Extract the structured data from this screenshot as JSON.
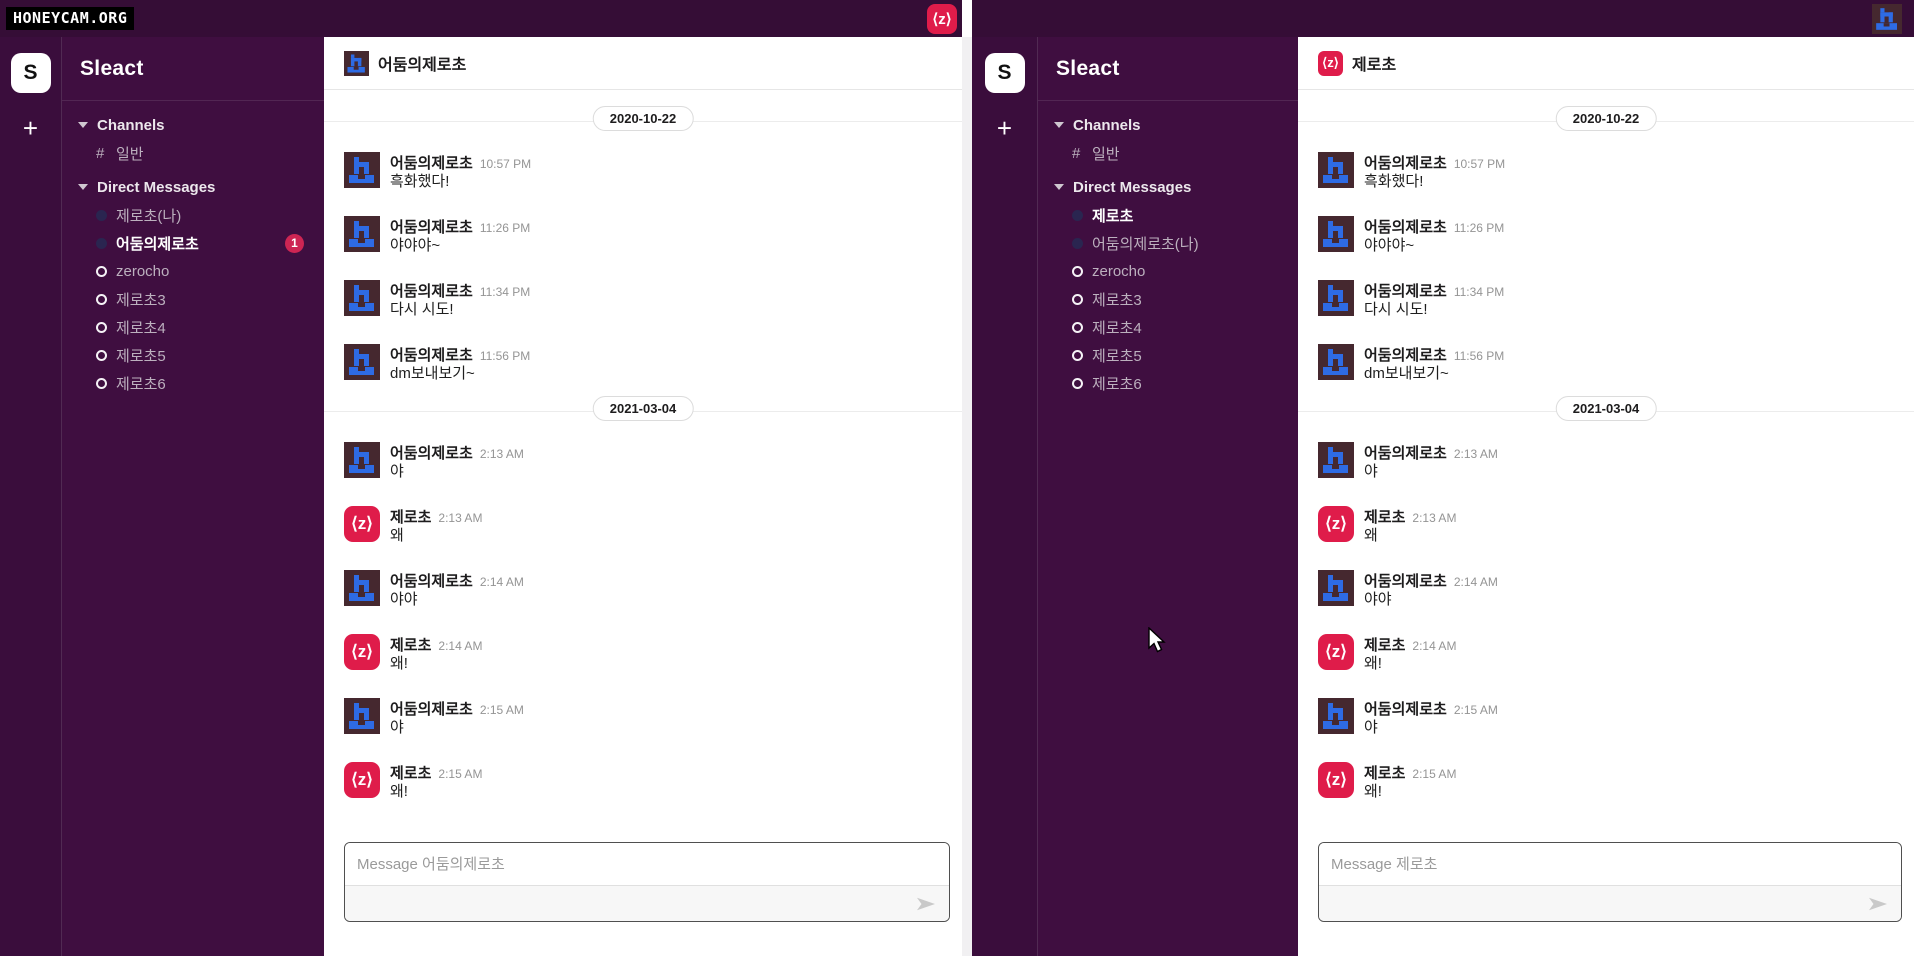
{
  "topbar": {
    "watermark": "HONEYCAM.ORG"
  },
  "icons": {
    "z_glyph": "⟨z⟩",
    "hash_glyph": "#"
  },
  "colors": {
    "topbar": "#350d36",
    "sidebar": "#3f0e40",
    "workspace": "#3a0d3c",
    "accent_red": "#df1c4a",
    "badge_red": "#cd2553",
    "avatar_blue": "#2e6be4",
    "avatar_bg": "#45282f",
    "muted_sidebar_text": "#bcb0be"
  },
  "windows": [
    {
      "workspace": {
        "initial": "S",
        "add_label": "+"
      },
      "sidebar": {
        "title": "Sleact",
        "channels_header": "Channels",
        "channels": [
          {
            "label": "일반"
          }
        ],
        "dm_header": "Direct Messages",
        "dms": [
          {
            "label": "제로초(나)",
            "state": "dot"
          },
          {
            "label": "어둠의제로초",
            "state": "dot",
            "bold": true,
            "badge": "1"
          },
          {
            "label": "zerocho",
            "state": "ring"
          },
          {
            "label": "제로초3",
            "state": "ring"
          },
          {
            "label": "제로초4",
            "state": "ring"
          },
          {
            "label": "제로초5",
            "state": "ring"
          },
          {
            "label": "제로초6",
            "state": "ring"
          }
        ]
      },
      "chat": {
        "title": "어둠의제로초",
        "input_placeholder": "Message 어둠의제로초",
        "items": [
          {
            "type": "divider",
            "date": "2020-10-22"
          },
          {
            "type": "message",
            "avatar": "pixel",
            "name": "어둠의제로초",
            "time": "10:57 PM",
            "text": "흑화했다!"
          },
          {
            "type": "message",
            "avatar": "pixel",
            "name": "어둠의제로초",
            "time": "11:26 PM",
            "text": "야야야~"
          },
          {
            "type": "message",
            "avatar": "pixel",
            "name": "어둠의제로초",
            "time": "11:34 PM",
            "text": "다시 시도!"
          },
          {
            "type": "message",
            "avatar": "pixel",
            "name": "어둠의제로초",
            "time": "11:56 PM",
            "text": "dm보내보기~"
          },
          {
            "type": "divider",
            "date": "2021-03-04"
          },
          {
            "type": "message",
            "avatar": "pixel",
            "name": "어둠의제로초",
            "time": "2:13 AM",
            "text": "야"
          },
          {
            "type": "message",
            "avatar": "z",
            "name": "제로초",
            "time": "2:13 AM",
            "text": "왜"
          },
          {
            "type": "message",
            "avatar": "pixel",
            "name": "어둠의제로초",
            "time": "2:14 AM",
            "text": "야야"
          },
          {
            "type": "message",
            "avatar": "z",
            "name": "제로초",
            "time": "2:14 AM",
            "text": "왜!"
          },
          {
            "type": "message",
            "avatar": "pixel",
            "name": "어둠의제로초",
            "time": "2:15 AM",
            "text": "야"
          },
          {
            "type": "message",
            "avatar": "z",
            "name": "제로초",
            "time": "2:15 AM",
            "text": "왜!"
          }
        ]
      }
    },
    {
      "workspace": {
        "initial": "S",
        "add_label": "+"
      },
      "sidebar": {
        "title": "Sleact",
        "channels_header": "Channels",
        "channels": [
          {
            "label": "일반"
          }
        ],
        "dm_header": "Direct Messages",
        "dms": [
          {
            "label": "제로초",
            "state": "dot",
            "bold": true
          },
          {
            "label": "어둠의제로초(나)",
            "state": "dot"
          },
          {
            "label": "zerocho",
            "state": "ring"
          },
          {
            "label": "제로초3",
            "state": "ring"
          },
          {
            "label": "제로초4",
            "state": "ring"
          },
          {
            "label": "제로초5",
            "state": "ring"
          },
          {
            "label": "제로초6",
            "state": "ring"
          }
        ]
      },
      "chat": {
        "title": "제로초",
        "input_placeholder": "Message 제로초",
        "items": [
          {
            "type": "divider",
            "date": "2020-10-22"
          },
          {
            "type": "message",
            "avatar": "pixel",
            "name": "어둠의제로초",
            "time": "10:57 PM",
            "text": "흑화했다!"
          },
          {
            "type": "message",
            "avatar": "pixel",
            "name": "어둠의제로초",
            "time": "11:26 PM",
            "text": "야야야~"
          },
          {
            "type": "message",
            "avatar": "pixel",
            "name": "어둠의제로초",
            "time": "11:34 PM",
            "text": "다시 시도!"
          },
          {
            "type": "message",
            "avatar": "pixel",
            "name": "어둠의제로초",
            "time": "11:56 PM",
            "text": "dm보내보기~"
          },
          {
            "type": "divider",
            "date": "2021-03-04"
          },
          {
            "type": "message",
            "avatar": "pixel",
            "name": "어둠의제로초",
            "time": "2:13 AM",
            "text": "야"
          },
          {
            "type": "message",
            "avatar": "z",
            "name": "제로초",
            "time": "2:13 AM",
            "text": "왜"
          },
          {
            "type": "message",
            "avatar": "pixel",
            "name": "어둠의제로초",
            "time": "2:14 AM",
            "text": "야야"
          },
          {
            "type": "message",
            "avatar": "z",
            "name": "제로초",
            "time": "2:14 AM",
            "text": "왜!"
          },
          {
            "type": "message",
            "avatar": "pixel",
            "name": "어둠의제로초",
            "time": "2:15 AM",
            "text": "야"
          },
          {
            "type": "message",
            "avatar": "z",
            "name": "제로초",
            "time": "2:15 AM",
            "text": "왜!"
          }
        ]
      }
    }
  ]
}
